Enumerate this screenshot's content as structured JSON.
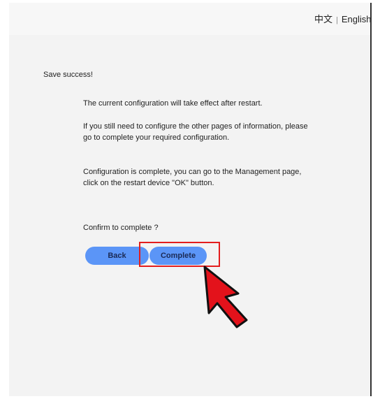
{
  "header": {
    "lang_chinese": "中文",
    "lang_separator": "|",
    "lang_english": "English"
  },
  "main": {
    "success_text": "Save success!",
    "message_restart": "The current configuration will take effect after restart.",
    "message_other_pages": "If you still need to configure the other pages of information,  please go to complete your required configuration.",
    "message_management": "Configuration is complete,  you can go to the Management page,  click on the restart device \"OK\" button.",
    "confirm_text": "Confirm to complete ?"
  },
  "buttons": {
    "back_label": "Back",
    "complete_label": "Complete"
  },
  "colors": {
    "button_blue": "#5b95f7",
    "highlight_red": "#e31d1d",
    "cursor_red": "#e3121b"
  },
  "icons": {
    "cursor": "arrow-pointer-icon"
  }
}
